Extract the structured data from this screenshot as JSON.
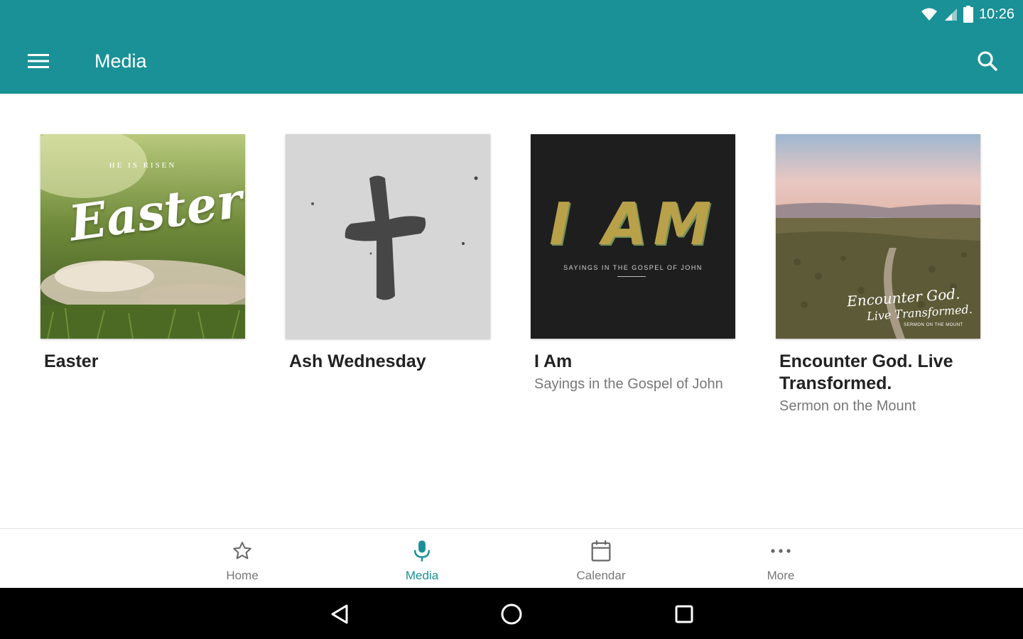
{
  "status_bar": {
    "time": "10:26"
  },
  "app_bar": {
    "title": "Media",
    "background": "#1a9196"
  },
  "series": [
    {
      "title": "Easter",
      "subtitle": "",
      "art_text": "HE IS RISEN",
      "art_script": "Easter"
    },
    {
      "title": "Ash Wednesday",
      "subtitle": ""
    },
    {
      "title": "I Am",
      "subtitle": "Sayings in the Gospel of John",
      "art_text": "I AM",
      "art_caption": "SAYINGS IN THE GOSPEL OF JOHN"
    },
    {
      "title": "Encounter God. Live Transformed.",
      "subtitle": "Sermon on the Mount",
      "art_script_1": "Encounter God.",
      "art_script_2": "Live Transformed.",
      "art_caption": "SERMON ON THE MOUNT"
    }
  ],
  "bottom_nav": {
    "items": [
      {
        "label": "Home",
        "icon": "star-outline-icon"
      },
      {
        "label": "Media",
        "icon": "microphone-icon",
        "active": true
      },
      {
        "label": "Calendar",
        "icon": "calendar-icon"
      },
      {
        "label": "More",
        "icon": "more-horizontal-icon"
      }
    ],
    "active_color": "#1a9196"
  },
  "system_nav": [
    "back",
    "home",
    "recents"
  ]
}
